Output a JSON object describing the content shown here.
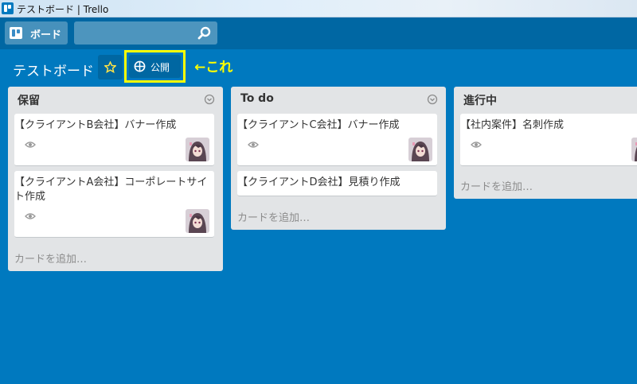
{
  "window": {
    "title": "テストボード | Trello"
  },
  "header": {
    "boards_label": "ボード",
    "search": {
      "value": "",
      "placeholder": ""
    }
  },
  "board": {
    "name": "テストボード",
    "visibility": "公開",
    "annotation": "←これ"
  },
  "colors": {
    "board_bg": "#0079bf",
    "header_bg": "#0067a3",
    "list_bg": "#e2e4e6",
    "highlight": "#ffff00"
  },
  "lists": [
    {
      "name": "保留",
      "cards": [
        {
          "title": "【クライアントB会社】バナー作成",
          "watching": true,
          "member": true
        },
        {
          "title": "【クライアントA会社】コーポレートサイト作成",
          "watching": true,
          "member": true
        }
      ],
      "add_card": "カードを追加…"
    },
    {
      "name": "To do",
      "cards": [
        {
          "title": "【クライアントC会社】バナー作成",
          "watching": true,
          "member": true
        },
        {
          "title": "【クライアントD会社】見積り作成",
          "watching": false,
          "member": false
        }
      ],
      "add_card": "カードを追加…"
    },
    {
      "name": "進行中",
      "cards": [
        {
          "title": "【社内案件】名刺作成",
          "watching": true,
          "member": true
        }
      ],
      "add_card": "カードを追加…"
    }
  ]
}
